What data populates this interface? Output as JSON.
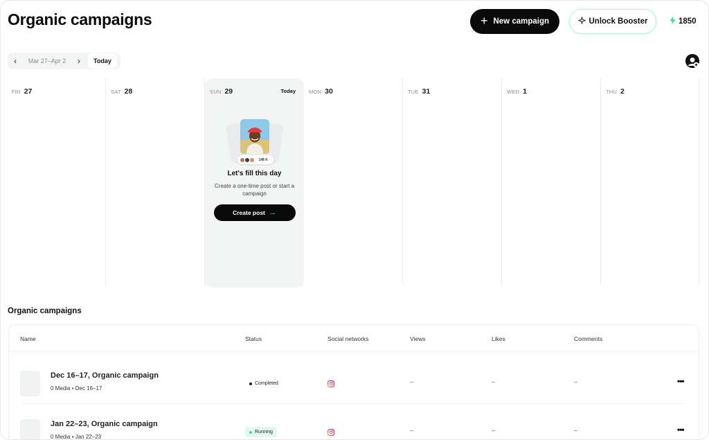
{
  "header": {
    "title": "Organic campaigns",
    "new_campaign_label": "New campaign",
    "booster_label": "Unlock Booster",
    "credits": "1850"
  },
  "date_nav": {
    "range": "Mar 27–Apr 2",
    "today_label": "Today"
  },
  "calendar": {
    "days": [
      {
        "dow": "FRI",
        "num": "27"
      },
      {
        "dow": "SAT",
        "num": "28"
      },
      {
        "dow": "SUN",
        "num": "29",
        "today": "Today"
      },
      {
        "dow": "MON",
        "num": "30"
      },
      {
        "dow": "TUE",
        "num": "31"
      },
      {
        "dow": "WED",
        "num": "1"
      },
      {
        "dow": "THU",
        "num": "2"
      }
    ],
    "fill_card": {
      "badge_count": "148 K",
      "title": "Let's fill this day",
      "subtitle": "Create a one-time post or start a campaign",
      "button_label": "Create post"
    }
  },
  "campaigns": {
    "section_title": "Organic campaigns",
    "columns": [
      "Name",
      "Status",
      "Social networks",
      "Views",
      "Likes",
      "Comments"
    ],
    "rows": [
      {
        "title": "Dec 16–17, Organic campaign",
        "media": "0 Media",
        "dates": "Dec 16–17",
        "status": "Completed",
        "views": "–",
        "likes": "–",
        "comments": "–"
      },
      {
        "title": "Jan 22–23, Organic campaign",
        "media": "0 Media",
        "dates": "Jan 22–23",
        "status": "Running",
        "views": "–",
        "likes": "–",
        "comments": "–"
      }
    ]
  },
  "icons": {
    "new_campaign": "plus-icon",
    "booster": "sparkle-icon",
    "credits": "lightning-icon",
    "prev": "chevron-left-icon",
    "next": "chevron-right-icon",
    "add_account": "add-account-icon",
    "social": "instagram-icon",
    "row_menu": "more-icon"
  },
  "colors": {
    "accent_green": "#3ddc97",
    "running_bg": "#e5f8ef",
    "running_dot": "#3ddc97",
    "completed_dot": "#222222"
  }
}
